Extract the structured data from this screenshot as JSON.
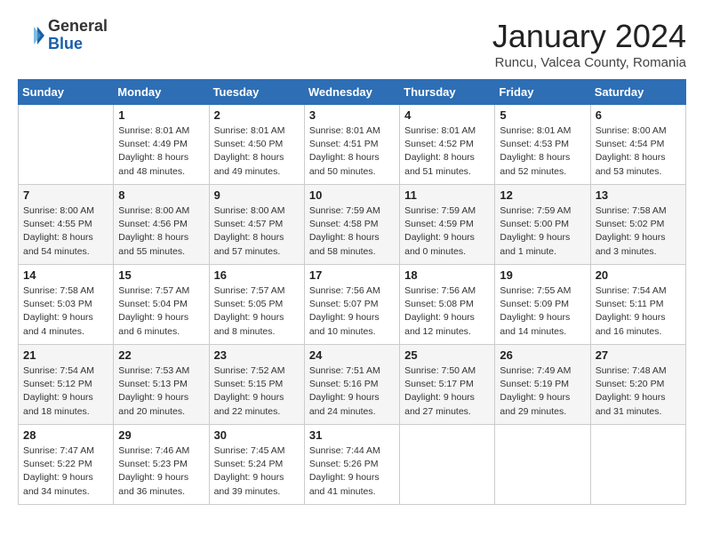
{
  "header": {
    "logo": {
      "line1": "General",
      "line2": "Blue"
    },
    "title": "January 2024",
    "location": "Runcu, Valcea County, Romania"
  },
  "days_of_week": [
    "Sunday",
    "Monday",
    "Tuesday",
    "Wednesday",
    "Thursday",
    "Friday",
    "Saturday"
  ],
  "weeks": [
    [
      {
        "day": "",
        "info": ""
      },
      {
        "day": "1",
        "info": "Sunrise: 8:01 AM\nSunset: 4:49 PM\nDaylight: 8 hours\nand 48 minutes."
      },
      {
        "day": "2",
        "info": "Sunrise: 8:01 AM\nSunset: 4:50 PM\nDaylight: 8 hours\nand 49 minutes."
      },
      {
        "day": "3",
        "info": "Sunrise: 8:01 AM\nSunset: 4:51 PM\nDaylight: 8 hours\nand 50 minutes."
      },
      {
        "day": "4",
        "info": "Sunrise: 8:01 AM\nSunset: 4:52 PM\nDaylight: 8 hours\nand 51 minutes."
      },
      {
        "day": "5",
        "info": "Sunrise: 8:01 AM\nSunset: 4:53 PM\nDaylight: 8 hours\nand 52 minutes."
      },
      {
        "day": "6",
        "info": "Sunrise: 8:00 AM\nSunset: 4:54 PM\nDaylight: 8 hours\nand 53 minutes."
      }
    ],
    [
      {
        "day": "7",
        "info": "Sunrise: 8:00 AM\nSunset: 4:55 PM\nDaylight: 8 hours\nand 54 minutes."
      },
      {
        "day": "8",
        "info": "Sunrise: 8:00 AM\nSunset: 4:56 PM\nDaylight: 8 hours\nand 55 minutes."
      },
      {
        "day": "9",
        "info": "Sunrise: 8:00 AM\nSunset: 4:57 PM\nDaylight: 8 hours\nand 57 minutes."
      },
      {
        "day": "10",
        "info": "Sunrise: 7:59 AM\nSunset: 4:58 PM\nDaylight: 8 hours\nand 58 minutes."
      },
      {
        "day": "11",
        "info": "Sunrise: 7:59 AM\nSunset: 4:59 PM\nDaylight: 9 hours\nand 0 minutes."
      },
      {
        "day": "12",
        "info": "Sunrise: 7:59 AM\nSunset: 5:00 PM\nDaylight: 9 hours\nand 1 minute."
      },
      {
        "day": "13",
        "info": "Sunrise: 7:58 AM\nSunset: 5:02 PM\nDaylight: 9 hours\nand 3 minutes."
      }
    ],
    [
      {
        "day": "14",
        "info": "Sunrise: 7:58 AM\nSunset: 5:03 PM\nDaylight: 9 hours\nand 4 minutes."
      },
      {
        "day": "15",
        "info": "Sunrise: 7:57 AM\nSunset: 5:04 PM\nDaylight: 9 hours\nand 6 minutes."
      },
      {
        "day": "16",
        "info": "Sunrise: 7:57 AM\nSunset: 5:05 PM\nDaylight: 9 hours\nand 8 minutes."
      },
      {
        "day": "17",
        "info": "Sunrise: 7:56 AM\nSunset: 5:07 PM\nDaylight: 9 hours\nand 10 minutes."
      },
      {
        "day": "18",
        "info": "Sunrise: 7:56 AM\nSunset: 5:08 PM\nDaylight: 9 hours\nand 12 minutes."
      },
      {
        "day": "19",
        "info": "Sunrise: 7:55 AM\nSunset: 5:09 PM\nDaylight: 9 hours\nand 14 minutes."
      },
      {
        "day": "20",
        "info": "Sunrise: 7:54 AM\nSunset: 5:11 PM\nDaylight: 9 hours\nand 16 minutes."
      }
    ],
    [
      {
        "day": "21",
        "info": "Sunrise: 7:54 AM\nSunset: 5:12 PM\nDaylight: 9 hours\nand 18 minutes."
      },
      {
        "day": "22",
        "info": "Sunrise: 7:53 AM\nSunset: 5:13 PM\nDaylight: 9 hours\nand 20 minutes."
      },
      {
        "day": "23",
        "info": "Sunrise: 7:52 AM\nSunset: 5:15 PM\nDaylight: 9 hours\nand 22 minutes."
      },
      {
        "day": "24",
        "info": "Sunrise: 7:51 AM\nSunset: 5:16 PM\nDaylight: 9 hours\nand 24 minutes."
      },
      {
        "day": "25",
        "info": "Sunrise: 7:50 AM\nSunset: 5:17 PM\nDaylight: 9 hours\nand 27 minutes."
      },
      {
        "day": "26",
        "info": "Sunrise: 7:49 AM\nSunset: 5:19 PM\nDaylight: 9 hours\nand 29 minutes."
      },
      {
        "day": "27",
        "info": "Sunrise: 7:48 AM\nSunset: 5:20 PM\nDaylight: 9 hours\nand 31 minutes."
      }
    ],
    [
      {
        "day": "28",
        "info": "Sunrise: 7:47 AM\nSunset: 5:22 PM\nDaylight: 9 hours\nand 34 minutes."
      },
      {
        "day": "29",
        "info": "Sunrise: 7:46 AM\nSunset: 5:23 PM\nDaylight: 9 hours\nand 36 minutes."
      },
      {
        "day": "30",
        "info": "Sunrise: 7:45 AM\nSunset: 5:24 PM\nDaylight: 9 hours\nand 39 minutes."
      },
      {
        "day": "31",
        "info": "Sunrise: 7:44 AM\nSunset: 5:26 PM\nDaylight: 9 hours\nand 41 minutes."
      },
      {
        "day": "",
        "info": ""
      },
      {
        "day": "",
        "info": ""
      },
      {
        "day": "",
        "info": ""
      }
    ]
  ]
}
